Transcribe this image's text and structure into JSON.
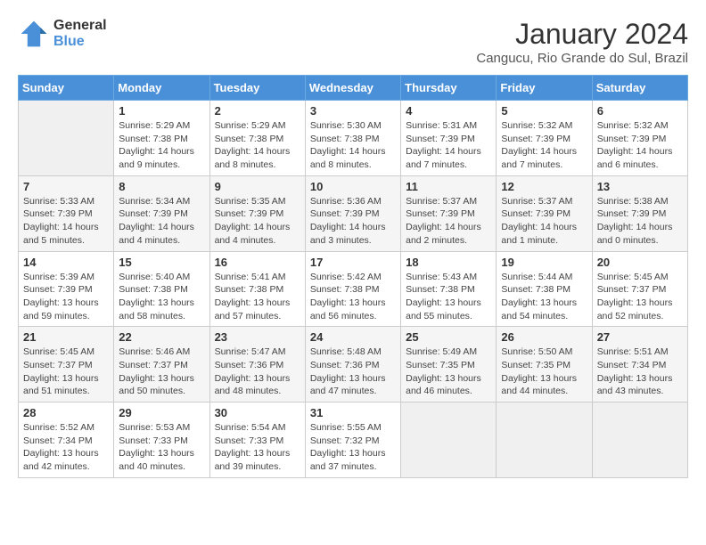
{
  "header": {
    "logo_line1": "General",
    "logo_line2": "Blue",
    "title": "January 2024",
    "subtitle": "Cangucu, Rio Grande do Sul, Brazil"
  },
  "weekdays": [
    "Sunday",
    "Monday",
    "Tuesday",
    "Wednesday",
    "Thursday",
    "Friday",
    "Saturday"
  ],
  "weeks": [
    [
      {
        "day": "",
        "empty": true
      },
      {
        "day": "1",
        "sunrise": "Sunrise: 5:29 AM",
        "sunset": "Sunset: 7:38 PM",
        "daylight": "Daylight: 14 hours and 9 minutes."
      },
      {
        "day": "2",
        "sunrise": "Sunrise: 5:29 AM",
        "sunset": "Sunset: 7:38 PM",
        "daylight": "Daylight: 14 hours and 8 minutes."
      },
      {
        "day": "3",
        "sunrise": "Sunrise: 5:30 AM",
        "sunset": "Sunset: 7:38 PM",
        "daylight": "Daylight: 14 hours and 8 minutes."
      },
      {
        "day": "4",
        "sunrise": "Sunrise: 5:31 AM",
        "sunset": "Sunset: 7:39 PM",
        "daylight": "Daylight: 14 hours and 7 minutes."
      },
      {
        "day": "5",
        "sunrise": "Sunrise: 5:32 AM",
        "sunset": "Sunset: 7:39 PM",
        "daylight": "Daylight: 14 hours and 7 minutes."
      },
      {
        "day": "6",
        "sunrise": "Sunrise: 5:32 AM",
        "sunset": "Sunset: 7:39 PM",
        "daylight": "Daylight: 14 hours and 6 minutes."
      }
    ],
    [
      {
        "day": "7",
        "sunrise": "Sunrise: 5:33 AM",
        "sunset": "Sunset: 7:39 PM",
        "daylight": "Daylight: 14 hours and 5 minutes."
      },
      {
        "day": "8",
        "sunrise": "Sunrise: 5:34 AM",
        "sunset": "Sunset: 7:39 PM",
        "daylight": "Daylight: 14 hours and 4 minutes."
      },
      {
        "day": "9",
        "sunrise": "Sunrise: 5:35 AM",
        "sunset": "Sunset: 7:39 PM",
        "daylight": "Daylight: 14 hours and 4 minutes."
      },
      {
        "day": "10",
        "sunrise": "Sunrise: 5:36 AM",
        "sunset": "Sunset: 7:39 PM",
        "daylight": "Daylight: 14 hours and 3 minutes."
      },
      {
        "day": "11",
        "sunrise": "Sunrise: 5:37 AM",
        "sunset": "Sunset: 7:39 PM",
        "daylight": "Daylight: 14 hours and 2 minutes."
      },
      {
        "day": "12",
        "sunrise": "Sunrise: 5:37 AM",
        "sunset": "Sunset: 7:39 PM",
        "daylight": "Daylight: 14 hours and 1 minute."
      },
      {
        "day": "13",
        "sunrise": "Sunrise: 5:38 AM",
        "sunset": "Sunset: 7:39 PM",
        "daylight": "Daylight: 14 hours and 0 minutes."
      }
    ],
    [
      {
        "day": "14",
        "sunrise": "Sunrise: 5:39 AM",
        "sunset": "Sunset: 7:39 PM",
        "daylight": "Daylight: 13 hours and 59 minutes."
      },
      {
        "day": "15",
        "sunrise": "Sunrise: 5:40 AM",
        "sunset": "Sunset: 7:38 PM",
        "daylight": "Daylight: 13 hours and 58 minutes."
      },
      {
        "day": "16",
        "sunrise": "Sunrise: 5:41 AM",
        "sunset": "Sunset: 7:38 PM",
        "daylight": "Daylight: 13 hours and 57 minutes."
      },
      {
        "day": "17",
        "sunrise": "Sunrise: 5:42 AM",
        "sunset": "Sunset: 7:38 PM",
        "daylight": "Daylight: 13 hours and 56 minutes."
      },
      {
        "day": "18",
        "sunrise": "Sunrise: 5:43 AM",
        "sunset": "Sunset: 7:38 PM",
        "daylight": "Daylight: 13 hours and 55 minutes."
      },
      {
        "day": "19",
        "sunrise": "Sunrise: 5:44 AM",
        "sunset": "Sunset: 7:38 PM",
        "daylight": "Daylight: 13 hours and 54 minutes."
      },
      {
        "day": "20",
        "sunrise": "Sunrise: 5:45 AM",
        "sunset": "Sunset: 7:37 PM",
        "daylight": "Daylight: 13 hours and 52 minutes."
      }
    ],
    [
      {
        "day": "21",
        "sunrise": "Sunrise: 5:45 AM",
        "sunset": "Sunset: 7:37 PM",
        "daylight": "Daylight: 13 hours and 51 minutes."
      },
      {
        "day": "22",
        "sunrise": "Sunrise: 5:46 AM",
        "sunset": "Sunset: 7:37 PM",
        "daylight": "Daylight: 13 hours and 50 minutes."
      },
      {
        "day": "23",
        "sunrise": "Sunrise: 5:47 AM",
        "sunset": "Sunset: 7:36 PM",
        "daylight": "Daylight: 13 hours and 48 minutes."
      },
      {
        "day": "24",
        "sunrise": "Sunrise: 5:48 AM",
        "sunset": "Sunset: 7:36 PM",
        "daylight": "Daylight: 13 hours and 47 minutes."
      },
      {
        "day": "25",
        "sunrise": "Sunrise: 5:49 AM",
        "sunset": "Sunset: 7:35 PM",
        "daylight": "Daylight: 13 hours and 46 minutes."
      },
      {
        "day": "26",
        "sunrise": "Sunrise: 5:50 AM",
        "sunset": "Sunset: 7:35 PM",
        "daylight": "Daylight: 13 hours and 44 minutes."
      },
      {
        "day": "27",
        "sunrise": "Sunrise: 5:51 AM",
        "sunset": "Sunset: 7:34 PM",
        "daylight": "Daylight: 13 hours and 43 minutes."
      }
    ],
    [
      {
        "day": "28",
        "sunrise": "Sunrise: 5:52 AM",
        "sunset": "Sunset: 7:34 PM",
        "daylight": "Daylight: 13 hours and 42 minutes."
      },
      {
        "day": "29",
        "sunrise": "Sunrise: 5:53 AM",
        "sunset": "Sunset: 7:33 PM",
        "daylight": "Daylight: 13 hours and 40 minutes."
      },
      {
        "day": "30",
        "sunrise": "Sunrise: 5:54 AM",
        "sunset": "Sunset: 7:33 PM",
        "daylight": "Daylight: 13 hours and 39 minutes."
      },
      {
        "day": "31",
        "sunrise": "Sunrise: 5:55 AM",
        "sunset": "Sunset: 7:32 PM",
        "daylight": "Daylight: 13 hours and 37 minutes."
      },
      {
        "day": "",
        "empty": true
      },
      {
        "day": "",
        "empty": true
      },
      {
        "day": "",
        "empty": true
      }
    ]
  ]
}
